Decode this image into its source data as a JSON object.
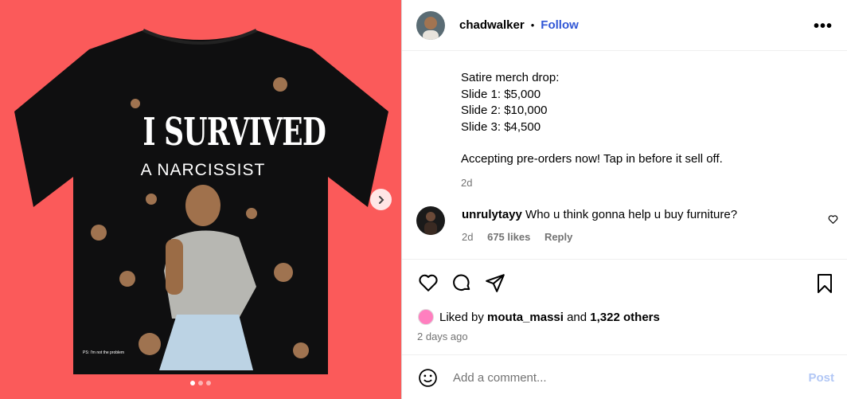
{
  "post": {
    "username": "chadwalker",
    "separator": "•",
    "follow_label": "Follow",
    "more_label": "•••"
  },
  "media": {
    "shirt_title": "I SURVIVED",
    "shirt_subtitle": "A NARCISSIST",
    "shirt_small_text": "PS: I'm not the problem",
    "slide_count": 3,
    "active_slide": 1,
    "colors": {
      "background": "#fb5a5a",
      "shirt": "#0f0f10"
    }
  },
  "caption": {
    "lines": [
      "Satire merch drop:",
      "Slide 1: $5,000",
      "Slide 2: $10,000",
      "Slide 3: $4,500"
    ],
    "second": "Accepting pre-orders now! Tap in before it sell off.",
    "time": "2d"
  },
  "comment": {
    "user": "unrulytayy",
    "text": "Who u think gonna help u buy furniture?",
    "time": "2d",
    "likes": "675 likes",
    "reply": "Reply"
  },
  "likes": {
    "prefix": "Liked by",
    "user": "mouta_massi",
    "middle": "and",
    "others": "1,322 others",
    "ago": "2 days ago"
  },
  "add_comment": {
    "placeholder": "Add a comment...",
    "post_label": "Post"
  },
  "colors": {
    "link": "#3157d6",
    "muted": "#737373",
    "post_disabled": "#b2c7f5"
  }
}
